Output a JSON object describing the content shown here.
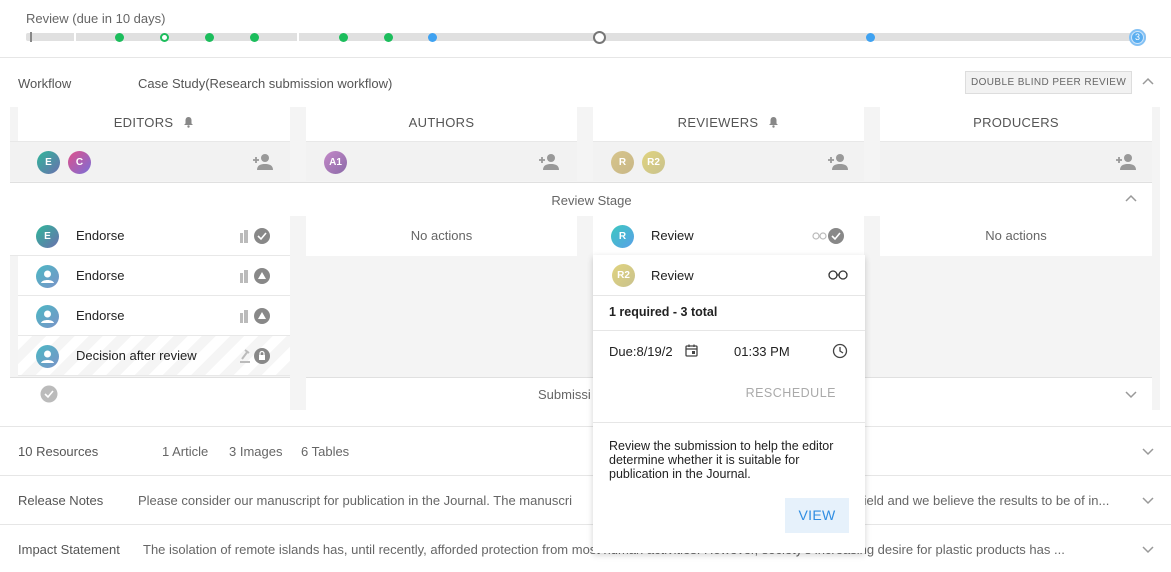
{
  "timeline": {
    "label": "Review (due in 10 days)",
    "current_step": "3"
  },
  "workflow": {
    "label": "Workflow",
    "name": "Case Study(Research submission workflow)",
    "badge": "DOUBLE BLIND PEER REVIEW"
  },
  "columns": {
    "editors": "EDITORS",
    "authors": "AUTHORS",
    "reviewers": "REVIEWERS",
    "producers": "PRODUCERS"
  },
  "avatars": {
    "editors": [
      "E",
      "C"
    ],
    "authors": [
      "A1"
    ],
    "reviewers": [
      "R",
      "R2"
    ]
  },
  "stage": {
    "title": "Review Stage",
    "bottom_title_partial": "Submissi"
  },
  "editor_rows": [
    {
      "avatar": "E",
      "label": "Endorse"
    },
    {
      "avatar": "",
      "label": "Endorse"
    },
    {
      "avatar": "",
      "label": "Endorse"
    },
    {
      "avatar": "",
      "label": "Decision after review"
    }
  ],
  "authors_cell": {
    "text": "No actions"
  },
  "producers_cell": {
    "text": "No actions"
  },
  "reviewer_rows": [
    {
      "avatar": "R",
      "label": "Review"
    }
  ],
  "popup": {
    "avatar": "R2",
    "label": "Review",
    "required": "1 required - 3 total",
    "due": "Due:8/19/2",
    "time": "01:33  PM",
    "reschedule": "RESCHEDULE",
    "description": "Review the submission to help the editor determine whether it is suitable for publication in the Journal.",
    "view": "VIEW"
  },
  "resources": {
    "label": "10 Resources",
    "article": "1 Article",
    "images": "3 Images",
    "tables": "6 Tables"
  },
  "release_notes": {
    "label": "Release Notes",
    "text_left": "Please consider our manuscript for publication in the Journal. The manuscri",
    "text_right": "field and we believe the results to be of in..."
  },
  "impact": {
    "label": "Impact Statement",
    "text": "The isolation of remote islands has, until recently, afforded protection from most human activities. However, society's increasing desire for plastic products has ..."
  },
  "colors": {
    "green": "#1cbd5c",
    "blue": "#3fa2f1",
    "accent": "#2f8de2"
  }
}
